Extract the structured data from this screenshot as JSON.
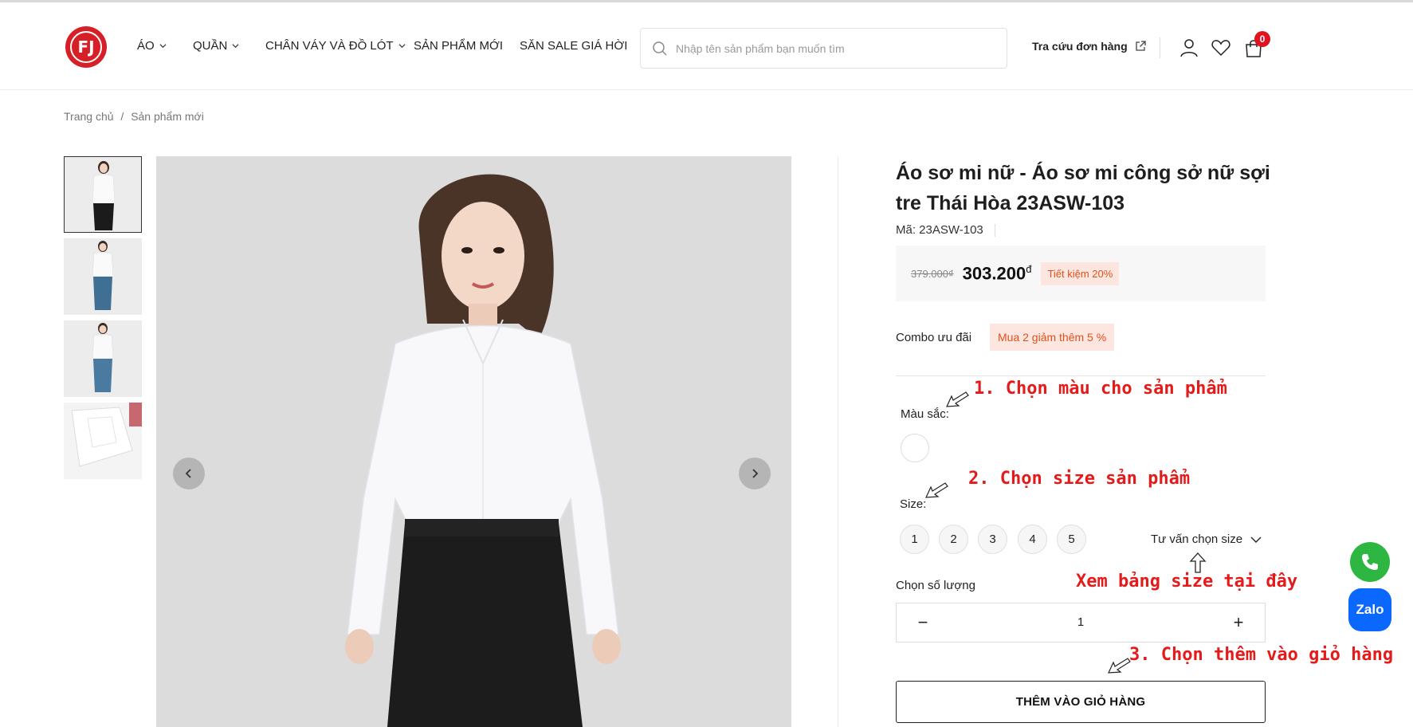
{
  "header": {
    "logo_text": "FJ",
    "nav": [
      {
        "label": "ÁO",
        "dropdown": true
      },
      {
        "label": "QUẦN",
        "dropdown": true
      },
      {
        "label": "CHÂN VÁY VÀ ĐỒ LÓT",
        "dropdown": true
      },
      {
        "label": "SẢN PHẨM MỚI",
        "dropdown": false
      },
      {
        "label": "SĂN SALE GIÁ HỜI",
        "dropdown": false
      }
    ],
    "search_placeholder": "Nhập tên sản phẩm bạn muốn tìm",
    "track_order": "Tra cứu đơn hàng",
    "cart_count": "0",
    "icons": [
      "search-icon",
      "external-link-icon",
      "user-icon",
      "heart-icon",
      "bag-icon"
    ]
  },
  "breadcrumb": {
    "home": "Trang chủ",
    "separator": "/",
    "current": "Sản phẩm mới"
  },
  "gallery": {
    "thumbnail_count": 4,
    "active_index": 0
  },
  "product": {
    "title": "Áo sơ mi nữ - Áo sơ mi công sở nữ sợi tre Thái Hòa 23ASW-103",
    "sku": "Mã: 23ASW-103",
    "old_price": "379.000₫",
    "price": "303.200",
    "currency": "đ",
    "save_badge": "Tiết kiệm 20%",
    "combo_label": "Combo ưu đãi",
    "combo_badge": "Mua 2 giảm thêm 5 %",
    "color_label": "Màu sắc:",
    "size_label": "Size:",
    "sizes": [
      "1",
      "2",
      "3",
      "4",
      "5"
    ],
    "size_guide": "Tư vấn chọn size",
    "qty_label": "Chọn số lượng",
    "qty_minus": "−",
    "qty_value": "1",
    "qty_plus": "+",
    "add_to_cart": "THÊM VÀO GIỎ HÀNG"
  },
  "annotations": {
    "step1": "1. Chọn màu cho sản phẩm",
    "step2": "2. Chọn size sản phẩm",
    "size_chart": "Xem bảng size tại đây",
    "step3": "3. Chọn thêm vào giỏ hàng"
  },
  "floating": {
    "zalo": "Zalo"
  },
  "colors": {
    "brand_red": "#d71f27",
    "accent_orange": "#e1501c",
    "annotation_red": "#e41b1b",
    "phone_green": "#2db742",
    "zalo_blue": "#0a68ff"
  }
}
